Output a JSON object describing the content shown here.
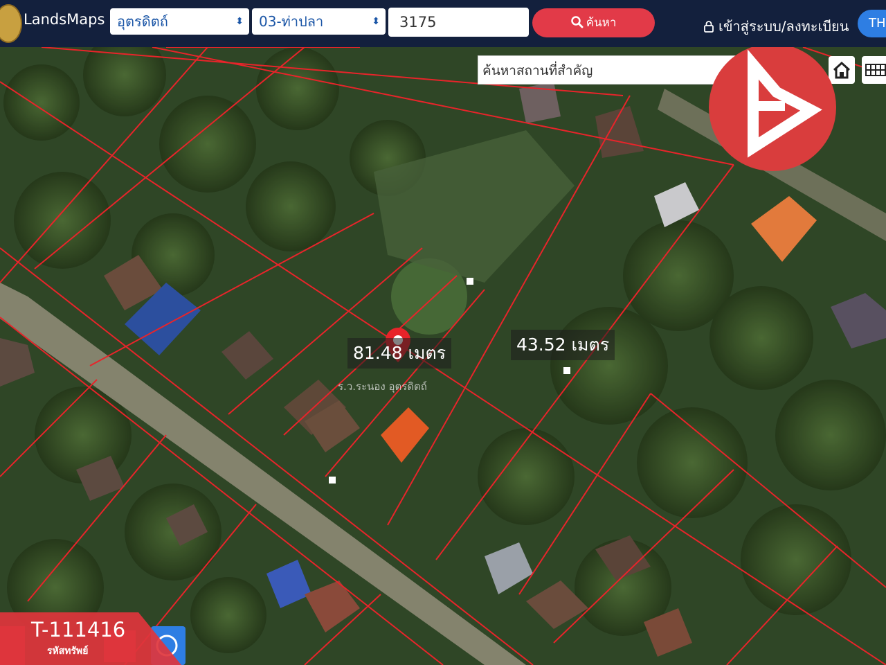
{
  "header": {
    "brand": "LandsMaps",
    "province_select": "อุตรดิตถ์",
    "district_select": "03-ท่าปลา",
    "parcel_number": "3175",
    "search_button": "ค้นหา",
    "login_label": "เข้าสู่ระบบ/ลงทะเบียน",
    "language": "TH"
  },
  "map": {
    "place_search_placeholder": "ค้นหาสถานที่สำคัญ",
    "measure_1": "81.48 เมตร",
    "measure_2": "43.52 เมตร",
    "parcel_label": "ร.ว.ระนอง อุตรดิตถ์"
  },
  "overlay": {
    "property_code": "T-111416",
    "property_code_label": "รหัสทรัพย์"
  },
  "colors": {
    "header_bg": "#13203d",
    "parcel_line": "#e8242a",
    "search_button": "#e23a48",
    "language_button": "#2e7ee3",
    "badge": "#d93d3d"
  }
}
